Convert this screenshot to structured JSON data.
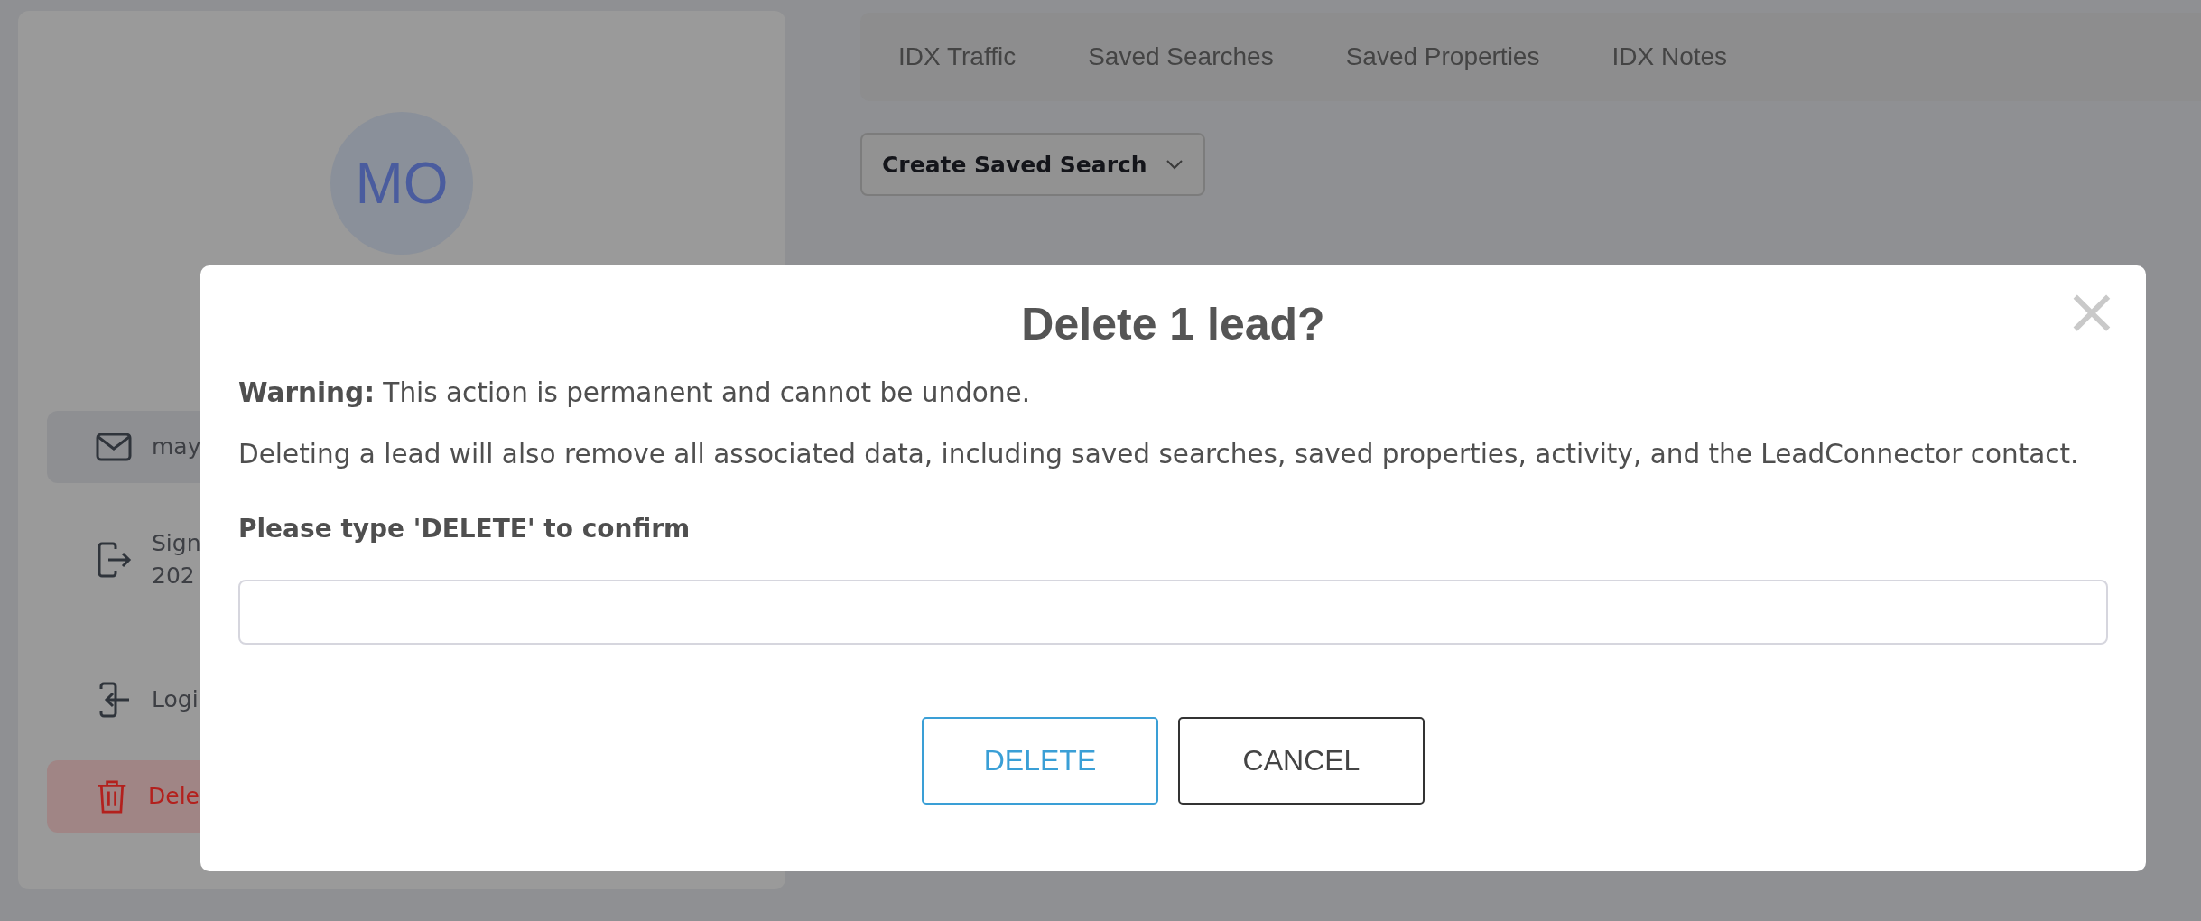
{
  "sidebar": {
    "avatar": "MO",
    "items": [
      {
        "kind": "email",
        "lines": [
          "may"
        ]
      },
      {
        "kind": "signup",
        "lines": [
          "Sign",
          "202"
        ]
      },
      {
        "kind": "login",
        "lines": [
          "Logi"
        ]
      },
      {
        "kind": "delete",
        "lines": [
          "Dele"
        ]
      }
    ]
  },
  "tabs": [
    {
      "label": "IDX Traffic"
    },
    {
      "label": "Saved Searches"
    },
    {
      "label": "Saved Properties"
    },
    {
      "label": "IDX Notes"
    }
  ],
  "create_button": {
    "label": "Create Saved Search"
  },
  "dialog": {
    "title": "Delete 1 lead?",
    "close": "×",
    "warning": "**Warning:** This action is permanent and cannot be undone.",
    "details": "Deleting a lead will also remove all associated data, including saved searches, saved properties, activity, and the LeadConnector contact.",
    "confirm_label": "Please type 'DELETE' to confirm",
    "buttons": [
      {
        "kind": "primary",
        "label": "DELETE"
      },
      {
        "kind": "secondary",
        "label": "CANCEL"
      }
    ]
  }
}
